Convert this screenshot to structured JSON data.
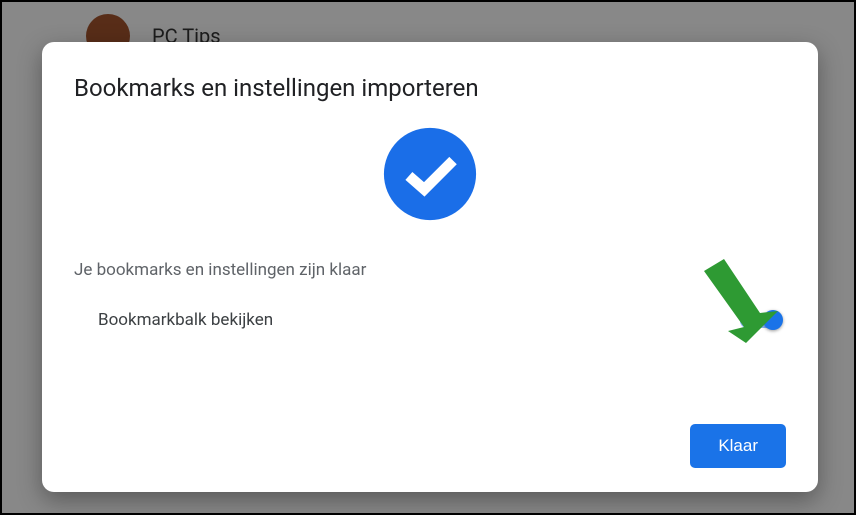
{
  "background": {
    "profile_name": "PC Tips"
  },
  "dialog": {
    "title": "Bookmarks en instellingen importeren",
    "status": "Je bookmarks en instellingen zijn klaar",
    "toggle_label": "Bookmarkbalk bekijken",
    "toggle_on": true,
    "done_label": "Klaar"
  },
  "colors": {
    "primary": "#1a73e8",
    "arrow": "#2e9a33"
  }
}
